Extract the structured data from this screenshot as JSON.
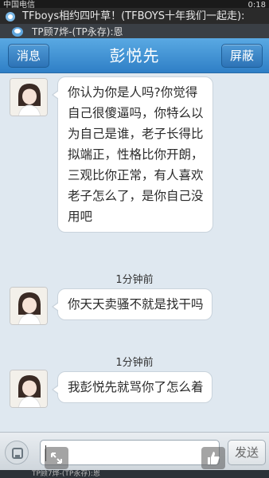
{
  "status_bar": {
    "left_text": "中国电信",
    "right_text": "0:18"
  },
  "notifications": [
    {
      "text": "TFboys相约四叶草！(TFBOYS十年我们一起走):"
    },
    {
      "text": "TP顾7烨-(TP永存):恩"
    }
  ],
  "header": {
    "back_label": "消息",
    "title": "彭悦先",
    "block_label": "屏蔽"
  },
  "messages": [
    {
      "type": "text",
      "text": "你认为你是人吗?你觉得自己很傻逼吗，你特么以为自己是谁，老子长得比拟端正，性格比你开朗，三观比你正常，有人喜欢老子怎么了，是你自己没用吧"
    },
    {
      "type": "time",
      "text": "1分钟前"
    },
    {
      "type": "text",
      "text": "你天天卖骚不就是找干吗"
    },
    {
      "type": "time",
      "text": "1分钟前"
    },
    {
      "type": "text",
      "text": "我彭悦先就骂你了怎么着"
    }
  ],
  "input_bar": {
    "send_label": "发送",
    "placeholder": ""
  },
  "bottom_notice": "TP顾7烨-(TP永存):恩",
  "colors": {
    "title_bar": "#3f8fd2",
    "chat_background": "#dfe8f0",
    "bubble": "#ffffff"
  },
  "icons": [
    "notification-icon",
    "avatar-girl",
    "plus-icon",
    "expand-icon",
    "thumbs-up-icon"
  ]
}
